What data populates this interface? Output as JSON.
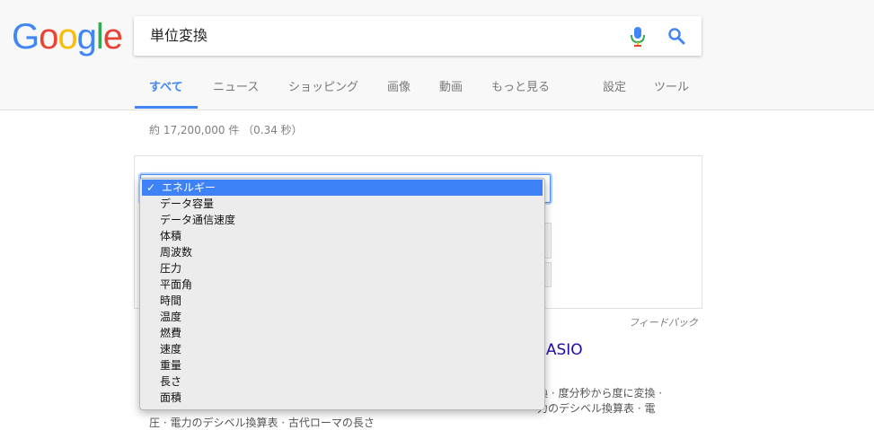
{
  "logo": {
    "letters": [
      "G",
      "o",
      "o",
      "g",
      "l",
      "e"
    ],
    "colors": [
      "#4285F4",
      "#EA4335",
      "#FBBC05",
      "#4285F4",
      "#34A853",
      "#EA4335"
    ]
  },
  "search": {
    "query": "単位変換"
  },
  "tabs": [
    {
      "label": "すべて",
      "active": true
    },
    {
      "label": "ニュース"
    },
    {
      "label": "ショッピング"
    },
    {
      "label": "画像"
    },
    {
      "label": "動画"
    },
    {
      "label": "もっと見る"
    },
    {
      "label": "設定"
    },
    {
      "label": "ツール"
    }
  ],
  "result_stats": "約 17,200,000 件 （0.34 秒）",
  "converter": {
    "selected_category": "エネルギー",
    "check_mark": "✓",
    "options": [
      "エネルギー",
      "データ容量",
      "データ通信速度",
      "体積",
      "周波数",
      "圧力",
      "平面角",
      "時間",
      "温度",
      "燃費",
      "速度",
      "重量",
      "長さ",
      "面積"
    ]
  },
  "feedback_label": "フィードバック",
  "result": {
    "title_fragment": "CASIO",
    "snippet_line1": "換 · 度分秒から度に変換 ·",
    "snippet_line2": "力のデシベル換算表 · 電",
    "snippet_line3": "圧 · 電力のデシベル換算表 · 古代ローマの長さ"
  },
  "colors": {
    "accent": "#4285f4",
    "link": "#1a0dab",
    "selected_option": "#3d82f6"
  }
}
